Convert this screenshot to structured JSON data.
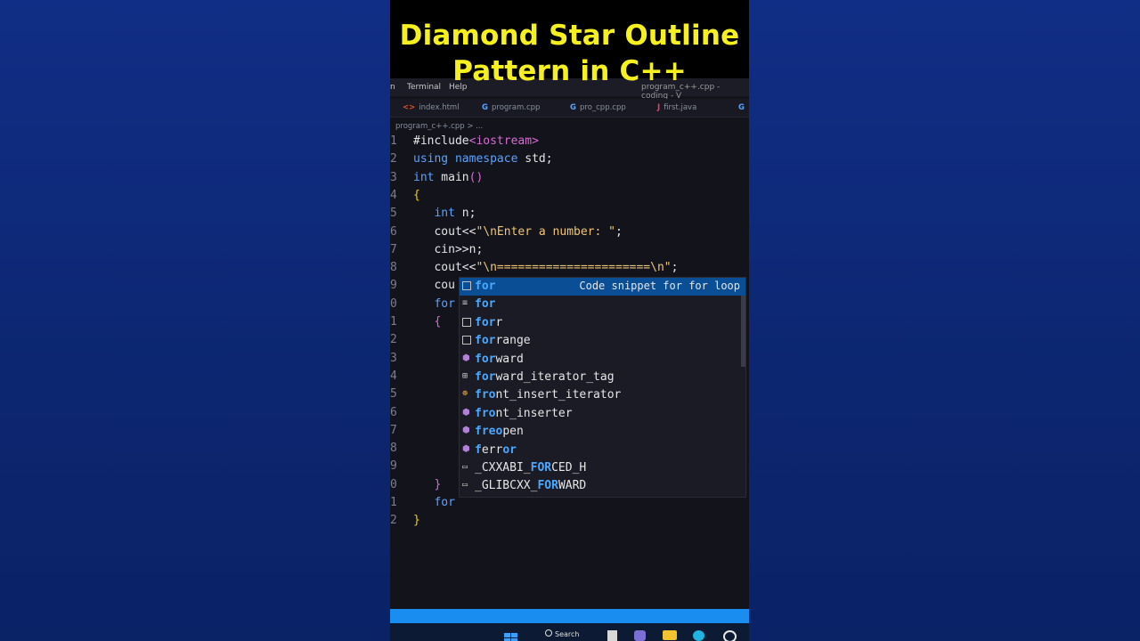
{
  "title": {
    "line1": "Diamond Star Outline",
    "line2": "Pattern in  C++"
  },
  "menubar": {
    "items": [
      "n",
      "Terminal",
      "Help"
    ],
    "window_title": "program_c++.cpp - coding - V"
  },
  "tabs": [
    {
      "icon": "<>",
      "label": "index.html"
    },
    {
      "icon": "G",
      "label": "program.cpp"
    },
    {
      "icon": "G",
      "label": "pro_cpp.cpp"
    },
    {
      "icon": "J",
      "label": "first.java"
    },
    {
      "icon": "G",
      "label": ""
    }
  ],
  "breadcrumb": "program_c++.cpp > ...",
  "line_numbers": [
    "1",
    "2",
    "3",
    "4",
    "5",
    "6",
    "7",
    "8",
    "9",
    "0",
    "1",
    "2",
    "3",
    "4",
    "5",
    "6",
    "7",
    "8",
    "9",
    "0",
    "1",
    "2"
  ],
  "code_lines": [
    {
      "parts": [
        [
          "",
          "#include"
        ],
        [
          "inc",
          "<iostream>"
        ]
      ]
    },
    {
      "parts": [
        [
          "kw",
          "using"
        ],
        [
          "",
          " "
        ],
        [
          "kw",
          "namespace"
        ],
        [
          "",
          " std;"
        ]
      ]
    },
    {
      "parts": [
        [
          "kw",
          "int"
        ],
        [
          "",
          " main"
        ],
        [
          "brace2",
          "()"
        ]
      ]
    },
    {
      "parts": [
        [
          "brace",
          "{"
        ]
      ]
    },
    {
      "parts": [
        [
          "",
          "   "
        ],
        [
          "kw",
          "int"
        ],
        [
          "",
          " n;"
        ]
      ]
    },
    {
      "parts": [
        [
          "",
          "   cout<<"
        ],
        [
          "str",
          "\"\\nEnter a number: \""
        ],
        [
          "",
          ";"
        ]
      ]
    },
    {
      "parts": [
        [
          "",
          "   cin>>n;"
        ]
      ]
    },
    {
      "parts": [
        [
          "",
          "   cout<<"
        ],
        [
          "str",
          "\"\\n======================\\n\""
        ],
        [
          "",
          ";"
        ]
      ]
    },
    {
      "parts": [
        [
          "",
          "   cou"
        ]
      ]
    },
    {
      "parts": [
        [
          "",
          "   "
        ],
        [
          "kw",
          "for"
        ]
      ]
    },
    {
      "parts": [
        [
          "",
          "   "
        ],
        [
          "brace2",
          "{"
        ]
      ]
    },
    {
      "parts": [
        [
          "",
          ""
        ]
      ]
    },
    {
      "parts": [
        [
          "",
          ""
        ]
      ]
    },
    {
      "parts": [
        [
          "",
          ""
        ]
      ]
    },
    {
      "parts": [
        [
          "",
          ""
        ]
      ]
    },
    {
      "parts": [
        [
          "",
          ""
        ]
      ]
    },
    {
      "parts": [
        [
          "",
          ""
        ]
      ]
    },
    {
      "parts": [
        [
          "",
          ""
        ]
      ]
    },
    {
      "parts": [
        [
          "",
          ""
        ]
      ]
    },
    {
      "parts": [
        [
          "",
          "   "
        ],
        [
          "brace2",
          "}"
        ]
      ]
    },
    {
      "parts": [
        [
          "",
          "   "
        ],
        [
          "kw",
          "for"
        ]
      ]
    },
    {
      "parts": [
        [
          "brace",
          "}"
        ]
      ]
    }
  ],
  "suggestions": [
    {
      "icon": "box",
      "match": "for",
      "rest": "",
      "detail": "Code snippet for for loop",
      "selected": true
    },
    {
      "icon": "kw",
      "match": "for",
      "rest": "",
      "detail": "",
      "selected": false
    },
    {
      "icon": "box",
      "match": "for",
      "rest": "r",
      "detail": "",
      "selected": false
    },
    {
      "icon": "box",
      "match": "for",
      "rest": "range",
      "detail": "",
      "selected": false
    },
    {
      "icon": "cube",
      "match": "for",
      "rest": "ward",
      "detail": "",
      "selected": false
    },
    {
      "icon": "struct",
      "match": "for",
      "rest": "ward_iterator_tag",
      "detail": "",
      "selected": false
    },
    {
      "icon": "cls",
      "match": "fro",
      "rest": "nt_insert_iterator",
      "detail": "",
      "selected": false
    },
    {
      "icon": "cube",
      "match": "fro",
      "rest": "nt_inserter",
      "detail": "",
      "selected": false
    },
    {
      "icon": "cube",
      "match": "freo",
      "rest": "pen",
      "detail": "",
      "selected": false
    },
    {
      "icon": "cube",
      "match": "f",
      "rest": "err",
      "tail": "or",
      "detail": "",
      "selected": false
    },
    {
      "icon": "const",
      "pre": "_CXXABI_",
      "match": "FOR",
      "rest": "CED_H",
      "detail": "",
      "selected": false
    },
    {
      "icon": "const",
      "pre": "_GLIBCXX_",
      "match": "FOR",
      "rest": "WARD",
      "detail": "",
      "selected": false
    }
  ],
  "taskbar": {
    "search_label": "Search"
  },
  "colors": {
    "title_yellow": "#f6f11e",
    "background_blue": "#0f2a78",
    "status_blue": "#1a8ef0",
    "selection_blue": "#0a4e95"
  }
}
